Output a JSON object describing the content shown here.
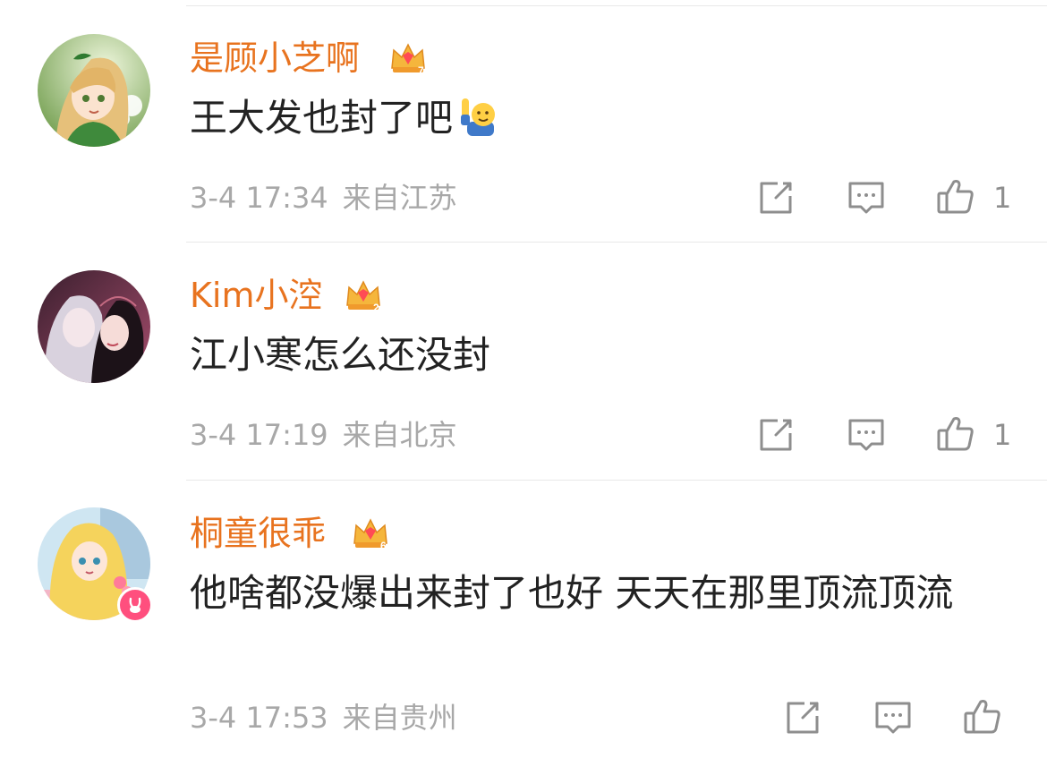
{
  "comments": [
    {
      "username": "是顾小芝啊",
      "crown_level": "7",
      "text": "王大发也封了吧",
      "emoji": "raising-hand-emoji",
      "date": "3-4 17:34",
      "location": "来自江苏",
      "likes": "1"
    },
    {
      "username": "Kim小涳",
      "crown_level": "2",
      "text": "江小寒怎么还没封",
      "date": "3-4 17:19",
      "location": "来自北京",
      "likes": "1"
    },
    {
      "username": "桐童很乖",
      "crown_level": "6",
      "text": "他啥都没爆出来封了也好 天天在那里顶流顶流",
      "date": "3-4 17:53",
      "location": "来自贵州",
      "likes": ""
    }
  ],
  "colors": {
    "username": "#e8731f",
    "text": "#222222",
    "meta": "#a8a8a8",
    "icon": "#8e8e8e",
    "verified_badge": "#ff4f7e"
  },
  "icons": {
    "repost": "share-icon",
    "reply": "comment-icon",
    "like": "thumbs-up-icon",
    "crown": "crown-icon"
  }
}
